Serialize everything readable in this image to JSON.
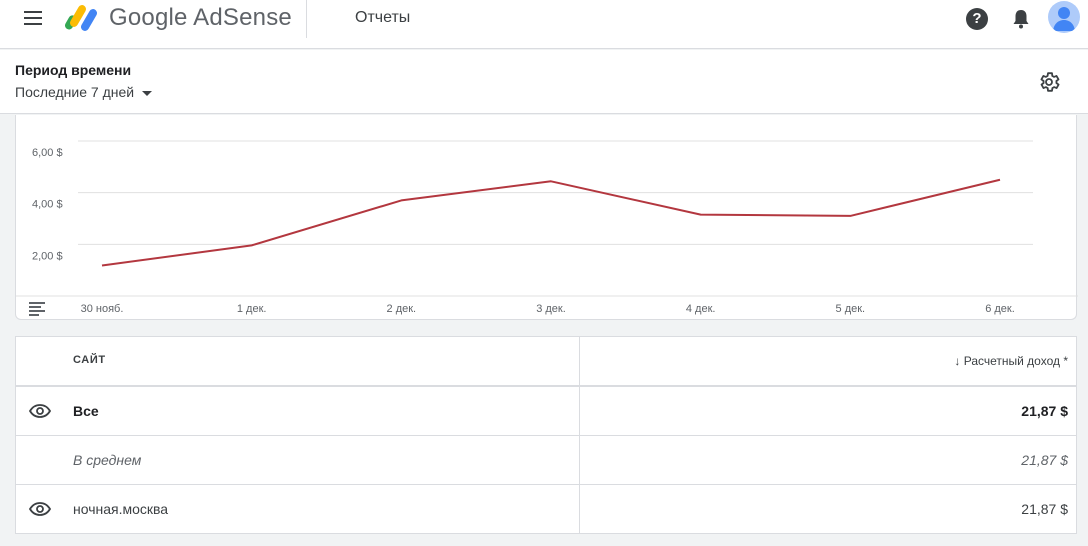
{
  "header": {
    "logo_text": "Google AdSense",
    "page_title": "Отчеты",
    "help_glyph": "?"
  },
  "filters": {
    "period_label": "Период времени",
    "period_value": "Последние 7 дней"
  },
  "chart_data": {
    "type": "line",
    "categories": [
      "30 нояб.",
      "1 дек.",
      "2 дек.",
      "3 дек.",
      "4 дек.",
      "5 дек.",
      "6 дек."
    ],
    "series": [
      {
        "values": [
          1.18,
          1.96,
          3.7,
          4.44,
          3.15,
          3.1,
          4.5
        ],
        "color": "#b3373f"
      }
    ],
    "y_ticks": [
      "2,00 $",
      "4,00 $",
      "6,00 $"
    ],
    "y_tick_values": [
      2,
      4,
      6
    ],
    "ylim": [
      0,
      6
    ],
    "grid": true,
    "title": "",
    "xlabel": "",
    "ylabel": ""
  },
  "table": {
    "col_site": "САЙТ",
    "col_income": "Расчетный доход *",
    "sort_glyph": "↓",
    "rows": [
      {
        "site": "Все",
        "value": "21,87 $",
        "style": "bold",
        "has_eye": true
      },
      {
        "site": "В среднем",
        "value": "21,87 $",
        "style": "italic",
        "has_eye": false
      },
      {
        "site": "ночная.москва",
        "value": "21,87 $",
        "style": "normal",
        "has_eye": true
      }
    ]
  },
  "colors": {
    "line": "#b3373f",
    "grid": "#e0e0e0",
    "text_secondary": "#5f6368"
  }
}
